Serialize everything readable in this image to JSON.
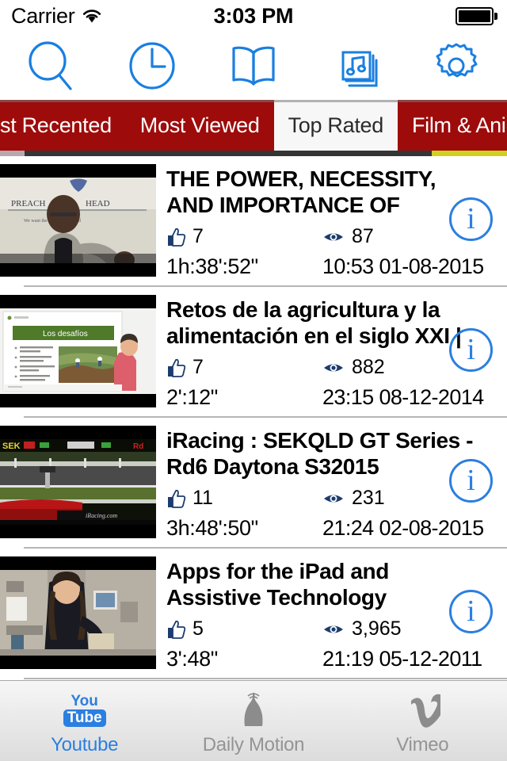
{
  "status_bar": {
    "carrier": "Carrier",
    "time": "3:03 PM",
    "wifi_icon": "wifi-icon",
    "battery_icon": "battery-full-icon"
  },
  "toolbar": {
    "items": [
      {
        "name": "search-icon",
        "label": "Search"
      },
      {
        "name": "history-icon",
        "label": "History"
      },
      {
        "name": "bookmarks-icon",
        "label": "Bookmarks"
      },
      {
        "name": "playlists-icon",
        "label": "Playlists"
      },
      {
        "name": "settings-icon",
        "label": "Settings"
      }
    ]
  },
  "categories": {
    "selected": "Top Rated",
    "accent_color": "#9e0b0b",
    "selected_bg": "#f7f7f7",
    "items": [
      {
        "label": "st Recented",
        "selected": false
      },
      {
        "label": "Most Viewed",
        "selected": false
      },
      {
        "label": "Top Rated",
        "selected": true
      },
      {
        "label": "Film & Animation",
        "selected": false
      }
    ]
  },
  "videos": [
    {
      "title": "THE POWER, NECESSITY, AND IMPORTANCE OF",
      "likes": "7",
      "views": "87",
      "duration": "1h:38':52\"",
      "date": "10:53 01-08-2015",
      "thumbnail": "preacher-podium",
      "info_label": "i"
    },
    {
      "title": "Retos de la agricultura y la alimentación en el siglo XXI |",
      "likes": "7",
      "views": "882",
      "duration": "2':12\"",
      "date": "23:15 08-12-2014",
      "thumbnail": "slide-los-desafios",
      "info_label": "i"
    },
    {
      "title": "iRacing : SEKQLD GT Series - Rd6 Daytona S32015",
      "likes": "11",
      "views": "231",
      "duration": "3h:48':50\"",
      "date": "21:24 02-08-2015",
      "thumbnail": "racing-track",
      "info_label": "i"
    },
    {
      "title": "Apps for the iPad and Assistive Technology",
      "likes": "5",
      "views": "3,965",
      "duration": "3':48\"",
      "date": "21:19 05-12-2011",
      "thumbnail": "woman-office",
      "info_label": "i"
    }
  ],
  "bottom_tabs": {
    "active": "Youtube",
    "active_color": "#2b7fe0",
    "inactive_color": "#949494",
    "items": [
      {
        "label": "Youtube",
        "icon": "youtube-icon",
        "active": true
      },
      {
        "label": "Daily Motion",
        "icon": "dailymotion-icon",
        "active": false
      },
      {
        "label": "Vimeo",
        "icon": "vimeo-icon",
        "active": false
      }
    ]
  }
}
